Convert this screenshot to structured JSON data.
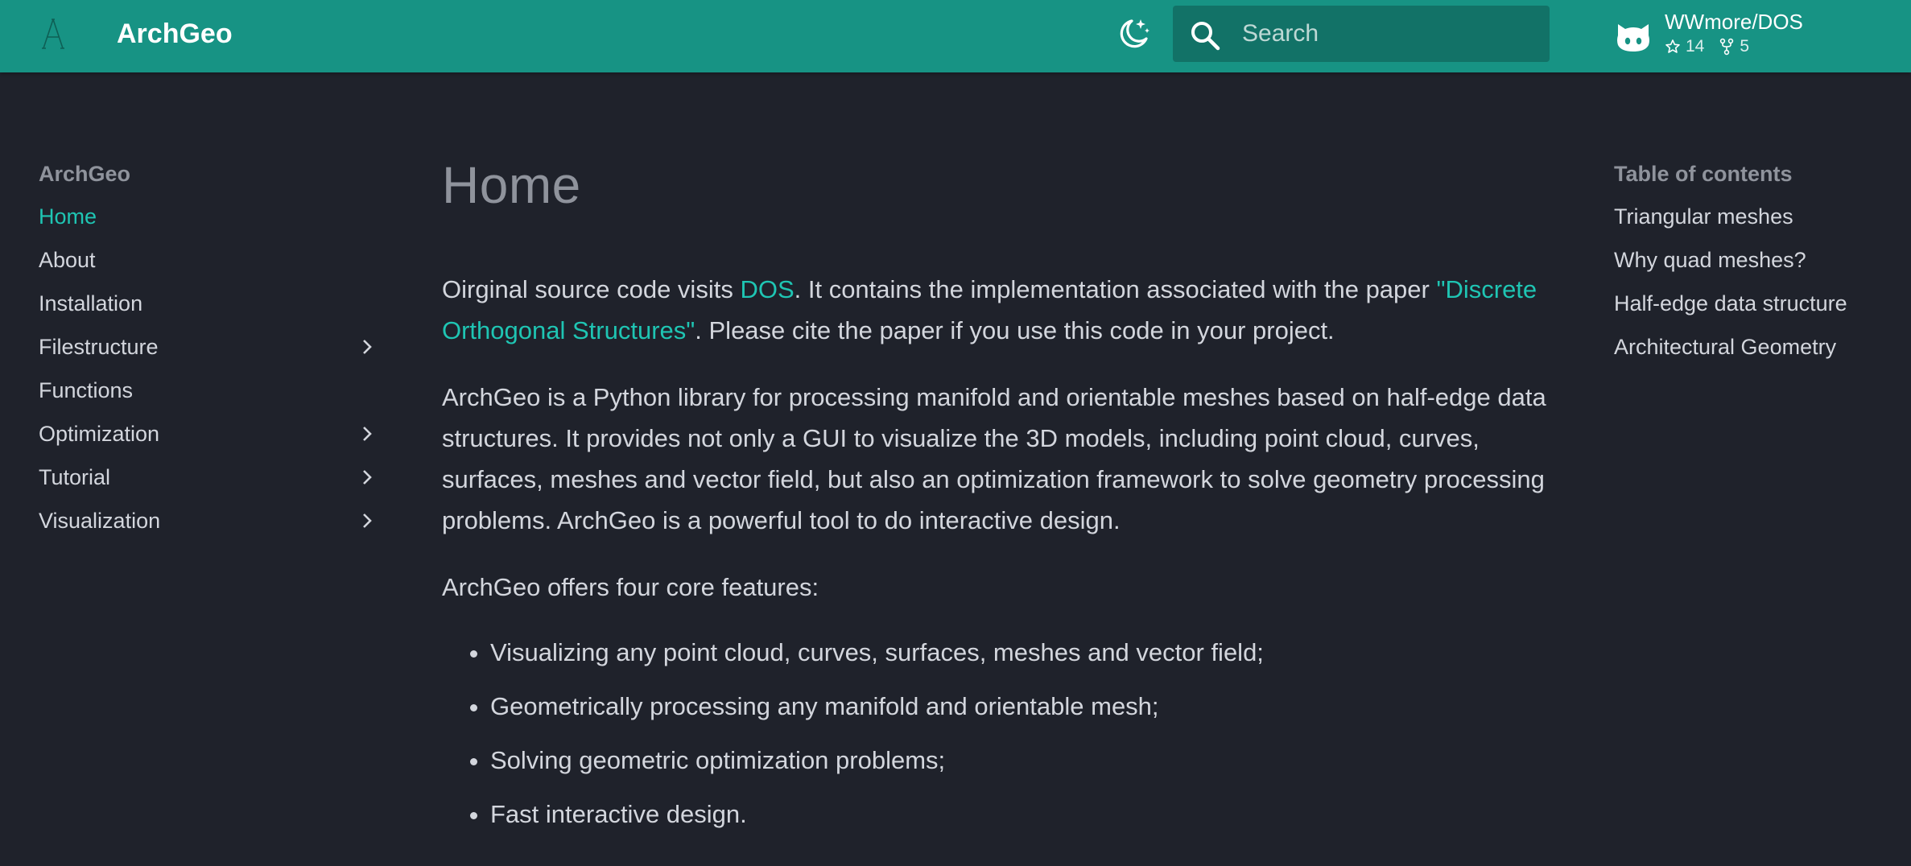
{
  "header": {
    "site_title": "ArchGeo",
    "search_placeholder": "Search",
    "repo": {
      "name": "WWmore/DOS",
      "stars": "14",
      "forks": "5"
    },
    "colors": {
      "primary": "#179384",
      "search_bg": "#127267",
      "accent": "#1fc5b3",
      "background": "#1f222b"
    },
    "icons": [
      "archgeo-logo-icon",
      "dark-mode-moon-icon",
      "search-icon",
      "github-icon",
      "star-icon",
      "fork-icon"
    ]
  },
  "nav": {
    "title": "ArchGeo",
    "items": [
      {
        "label": "Home",
        "active": true,
        "expandable": false
      },
      {
        "label": "About",
        "active": false,
        "expandable": false
      },
      {
        "label": "Installation",
        "active": false,
        "expandable": false
      },
      {
        "label": "Filestructure",
        "active": false,
        "expandable": true
      },
      {
        "label": "Functions",
        "active": false,
        "expandable": false
      },
      {
        "label": "Optimization",
        "active": false,
        "expandable": true
      },
      {
        "label": "Tutorial",
        "active": false,
        "expandable": true
      },
      {
        "label": "Visualization",
        "active": false,
        "expandable": true
      }
    ]
  },
  "main": {
    "title": "Home",
    "p1": {
      "t1": "Oirginal source code visits ",
      "link1": "DOS",
      "t2": ". It contains the implementation associated with the paper ",
      "link2": "\"Discrete Orthogonal Structures\"",
      "t3": ". Please cite the paper if you use this code in your project."
    },
    "p2": "ArchGeo is a Python library for processing manifold and orientable meshes based on half-edge data structures. It provides not only a GUI to visualize the 3D models, including point cloud, curves, surfaces, meshes and vector field, but also an optimization framework to solve geometry processing problems. ArchGeo is a powerful tool to do interactive design.",
    "p3": "ArchGeo offers four core features:",
    "features": [
      "Visualizing any point cloud, curves, surfaces, meshes and vector field;",
      "Geometrically processing any manifold and orientable mesh;",
      "Solving geometric optimization problems;",
      "Fast interactive design."
    ]
  },
  "toc": {
    "title": "Table of contents",
    "items": [
      "Triangular meshes",
      "Why quad meshes?",
      "Half-edge data structure",
      "Architectural Geometry"
    ]
  }
}
